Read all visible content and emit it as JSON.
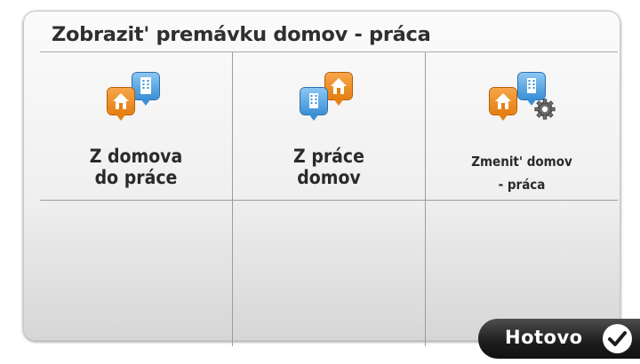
{
  "screen": {
    "title": "Zobrazit' premávku domov - práca"
  },
  "tiles": [
    {
      "label": "Z domova\ndo práce",
      "icon": "home-to-work-icon"
    },
    {
      "label": "Z práce\ndomov",
      "icon": "work-to-home-icon"
    },
    {
      "label": "Zmenit' domov\n- práca",
      "icon": "change-home-work-icon"
    }
  ],
  "footer": {
    "done_label": "Hotovo",
    "done_icon": "checkmark-icon"
  },
  "colors": {
    "orange_pin": "#e67e10",
    "blue_pin": "#3a8fd6",
    "button_dark": "#1c1c1c"
  }
}
